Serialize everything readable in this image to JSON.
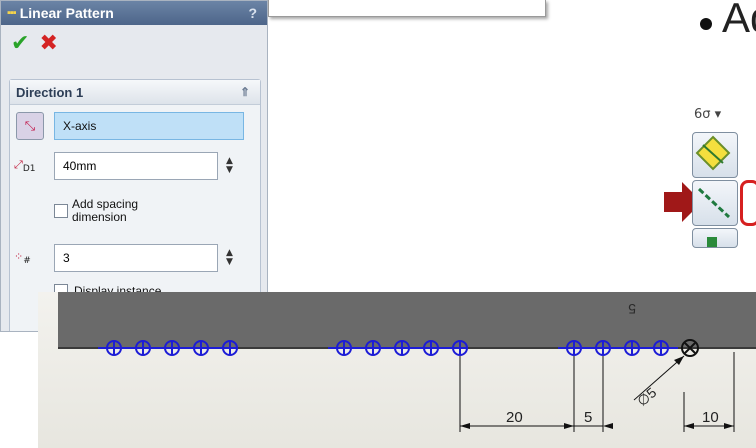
{
  "slide": {
    "bullet_text": "Ad"
  },
  "linear_pattern": {
    "title": "Linear Pattern",
    "help": "?",
    "ok_symbol": "✔",
    "cancel_symbol": "✖",
    "direction_group": {
      "title": "Direction 1",
      "collapse_symbol": "⇑",
      "direction_reference": "X-axis",
      "spacing_icon_sub": "D1",
      "spacing_value": "40mm",
      "add_spacing_label_line1": "Add spacing",
      "add_spacing_label_line2": "dimension",
      "add_spacing_checked": false,
      "instances_icon_sub": "#",
      "instances_value": "3",
      "display_instance_label": "Display instance"
    }
  },
  "toolbar": {
    "dropdown_symbol": "6σ ▾"
  },
  "drawing": {
    "label_top": "5",
    "dim_20": "20",
    "dim_5": "5",
    "dim_10": "10",
    "dia_label": "∅5"
  },
  "colors": {
    "accent_blue": "#1c1cd6",
    "arrow_red": "#a01818",
    "highlight_red": "#d62020"
  }
}
